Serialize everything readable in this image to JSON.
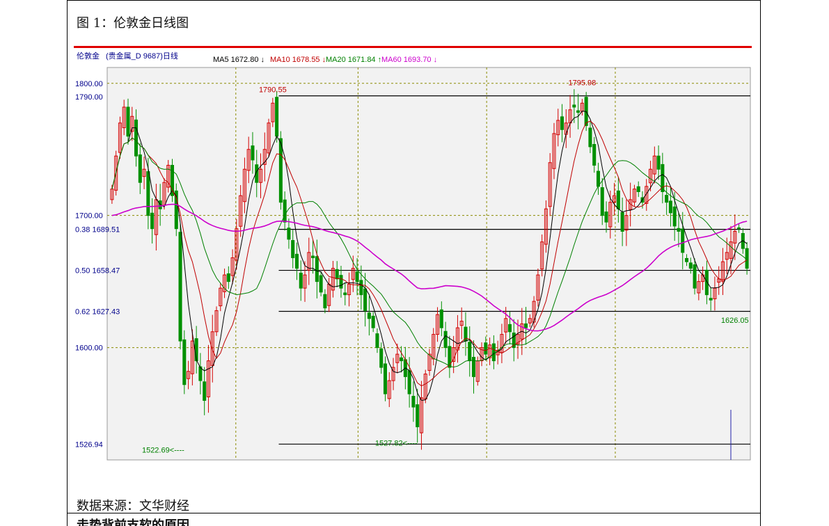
{
  "figure_title": "图 1：伦敦金日线图",
  "source_note": "数据来源：文华财经",
  "next_section_title": "走势背前支软的原因",
  "chart_data": {
    "type": "candlestick",
    "title": "",
    "header": {
      "instrument": "伦敦金",
      "contract": "(贵金属_D 9687)日线",
      "indicators": [
        {
          "label": "MA5 1672.80 ↓",
          "color": "#000000"
        },
        {
          "label": "MA10 1678.55 ↓",
          "color": "#c00000"
        },
        {
          "label": "MA20 1671.84 ↑",
          "color": "#008000"
        },
        {
          "label": "MA60 1693.70 ↓",
          "color": "#cc00cc"
        }
      ]
    },
    "ylim": [
      1515,
      1812
    ],
    "y_ticks": [
      {
        "value": 1800,
        "label": "1800.00"
      },
      {
        "value": 1790,
        "label": "1790.00"
      },
      {
        "value": 1700,
        "label": "1700.00"
      },
      {
        "value": 1689.51,
        "label": "0.38 1689.51"
      },
      {
        "value": 1658.47,
        "label": "0.50 1658.47"
      },
      {
        "value": 1627.43,
        "label": "0.62 1627.43"
      },
      {
        "value": 1600,
        "label": "1600.00"
      },
      {
        "value": 1526.94,
        "label": "1526.94"
      }
    ],
    "fib_levels": [
      {
        "value": 1790.55,
        "start_index": 42
      },
      {
        "value": 1689.51,
        "start_index": 42
      },
      {
        "value": 1658.47,
        "start_index": 42
      },
      {
        "value": 1627.43,
        "start_index": 42
      },
      {
        "value": 1526.94,
        "start_index": 42
      }
    ],
    "annotations": [
      {
        "label": "1790.55",
        "index": 40,
        "value": 1790.55,
        "color": "#c00000",
        "anchor": "above"
      },
      {
        "label": "1795.98",
        "index": 117,
        "value": 1795.98,
        "color": "#c00000",
        "anchor": "above"
      },
      {
        "label": "1522.69",
        "index": 18,
        "value": 1522.69,
        "color": "#008000",
        "anchor": "left-arrow"
      },
      {
        "label": "1527.82",
        "index": 76,
        "value": 1527.82,
        "color": "#008000",
        "anchor": "left-arrow"
      },
      {
        "label": "1626.05",
        "index": 155,
        "value": 1626.05,
        "color": "#008000",
        "anchor": "below"
      }
    ],
    "closes": [
      1720,
      1745,
      1770,
      1782,
      1760,
      1775,
      1745,
      1725,
      1735,
      1700,
      1690,
      1712,
      1705,
      1725,
      1738,
      1715,
      1690,
      1605,
      1572,
      1582,
      1605,
      1590,
      1575,
      1560,
      1590,
      1612,
      1628,
      1645,
      1655,
      1650,
      1668,
      1690,
      1715,
      1735,
      1750,
      1742,
      1725,
      1735,
      1750,
      1770,
      1785,
      1760,
      1710,
      1695,
      1682,
      1668,
      1660,
      1645,
      1655,
      1672,
      1668,
      1650,
      1642,
      1630,
      1648,
      1660,
      1652,
      1645,
      1640,
      1648,
      1660,
      1650,
      1640,
      1628,
      1622,
      1615,
      1600,
      1585,
      1565,
      1575,
      1585,
      1595,
      1590,
      1578,
      1565,
      1555,
      1540,
      1562,
      1580,
      1595,
      1610,
      1625,
      1615,
      1600,
      1585,
      1600,
      1615,
      1620,
      1605,
      1590,
      1578,
      1590,
      1600,
      1595,
      1602,
      1590,
      1598,
      1610,
      1622,
      1612,
      1600,
      1610,
      1618,
      1615,
      1622,
      1635,
      1655,
      1680,
      1705,
      1740,
      1762,
      1772,
      1765,
      1770,
      1780,
      1782,
      1778,
      1785,
      1768,
      1752,
      1738,
      1722,
      1700,
      1695,
      1710,
      1715,
      1705,
      1688,
      1700,
      1712,
      1720,
      1718,
      1710,
      1722,
      1735,
      1745,
      1735,
      1718,
      1710,
      1702,
      1692,
      1688,
      1672,
      1665,
      1660,
      1645,
      1650,
      1655,
      1640,
      1636,
      1645,
      1652,
      1665,
      1672,
      1680,
      1688,
      1690,
      1675,
      1660
    ]
  }
}
